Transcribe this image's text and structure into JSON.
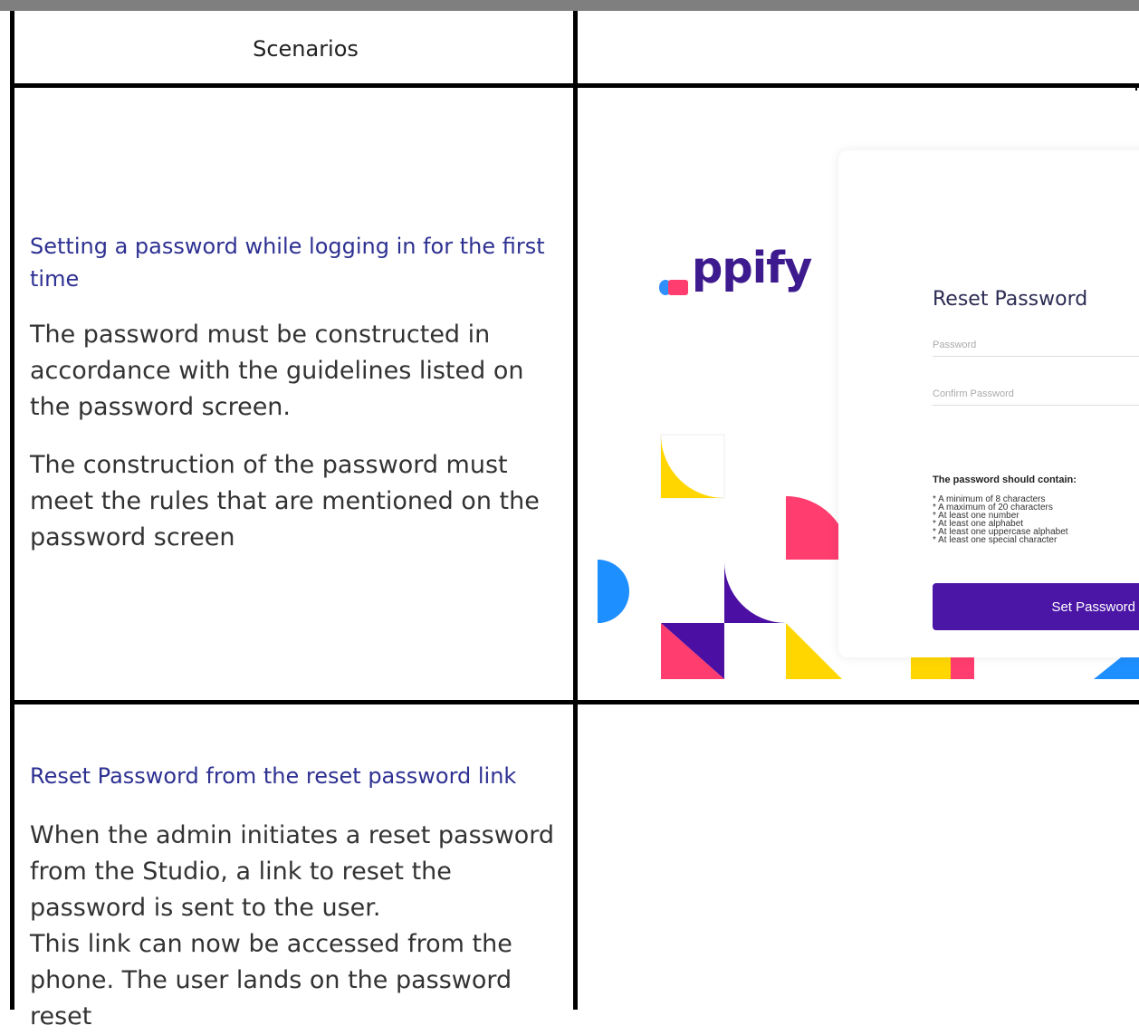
{
  "table": {
    "header_left": "Scenarios",
    "header_right": ""
  },
  "row1": {
    "title": "Setting a password while logging in for the first time",
    "para1": "The password must be constructed in accordance with the guidelines listed on the password screen.",
    "para2": "The construction of the password must meet the rules that are mentioned on the password screen"
  },
  "screen": {
    "logo_text": "ppify",
    "title": "Reset Password",
    "password_placeholder": "Password",
    "confirm_placeholder": "Confirm Password",
    "rules_heading": "The password should contain:",
    "rules": [
      "* A minimum of 8 characters",
      "* A maximum of 20 characters",
      "* At least one number",
      "* At least one alphabet",
      "* At least one uppercase alphabet",
      "* At least one special character"
    ],
    "button_label": "Set Password"
  },
  "row2": {
    "title": "Reset Password from the reset password link",
    "para1": "When the admin initiates a reset password from the Studio, a link to reset the password is sent to the user.",
    "para2": "This link can now be accessed from the phone. The user lands on the password reset"
  }
}
